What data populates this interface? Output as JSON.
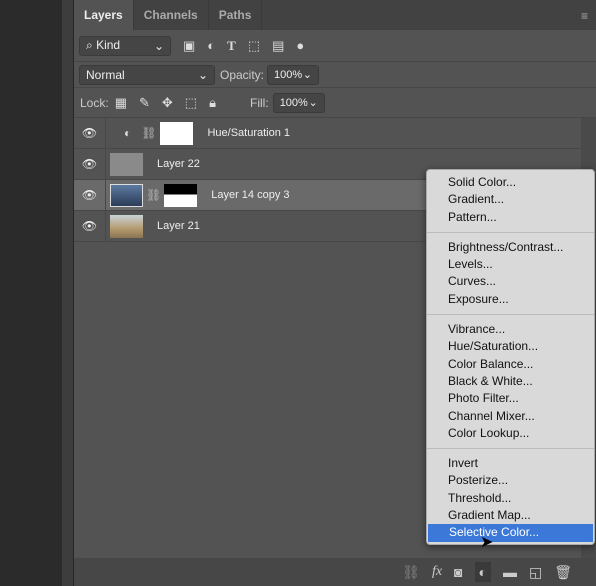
{
  "tabs": [
    "Layers",
    "Channels",
    "Paths"
  ],
  "filter": {
    "kind": "Kind"
  },
  "blend": {
    "mode": "Normal",
    "opacity_label": "Opacity:",
    "opacity": "100%"
  },
  "lock": {
    "label": "Lock:",
    "fill_label": "Fill:",
    "fill": "100%"
  },
  "layers": [
    {
      "name": "Hue/Saturation 1",
      "type": "adjustment"
    },
    {
      "name": "Layer 22",
      "type": "fill"
    },
    {
      "name": "Layer 14 copy 3",
      "type": "image-masked",
      "selected": true
    },
    {
      "name": "Layer 21",
      "type": "image"
    }
  ],
  "menu": [
    [
      "Solid Color...",
      "Gradient...",
      "Pattern..."
    ],
    [
      "Brightness/Contrast...",
      "Levels...",
      "Curves...",
      "Exposure..."
    ],
    [
      "Vibrance...",
      "Hue/Saturation...",
      "Color Balance...",
      "Black & White...",
      "Photo Filter...",
      "Channel Mixer...",
      "Color Lookup..."
    ],
    [
      "Invert",
      "Posterize...",
      "Threshold...",
      "Gradient Map...",
      "Selective Color..."
    ]
  ],
  "highlighted": "Selective Color...",
  "colors": {
    "panel": "#535353",
    "highlight": "#3c78d8",
    "menu": "#d9d9d9"
  }
}
